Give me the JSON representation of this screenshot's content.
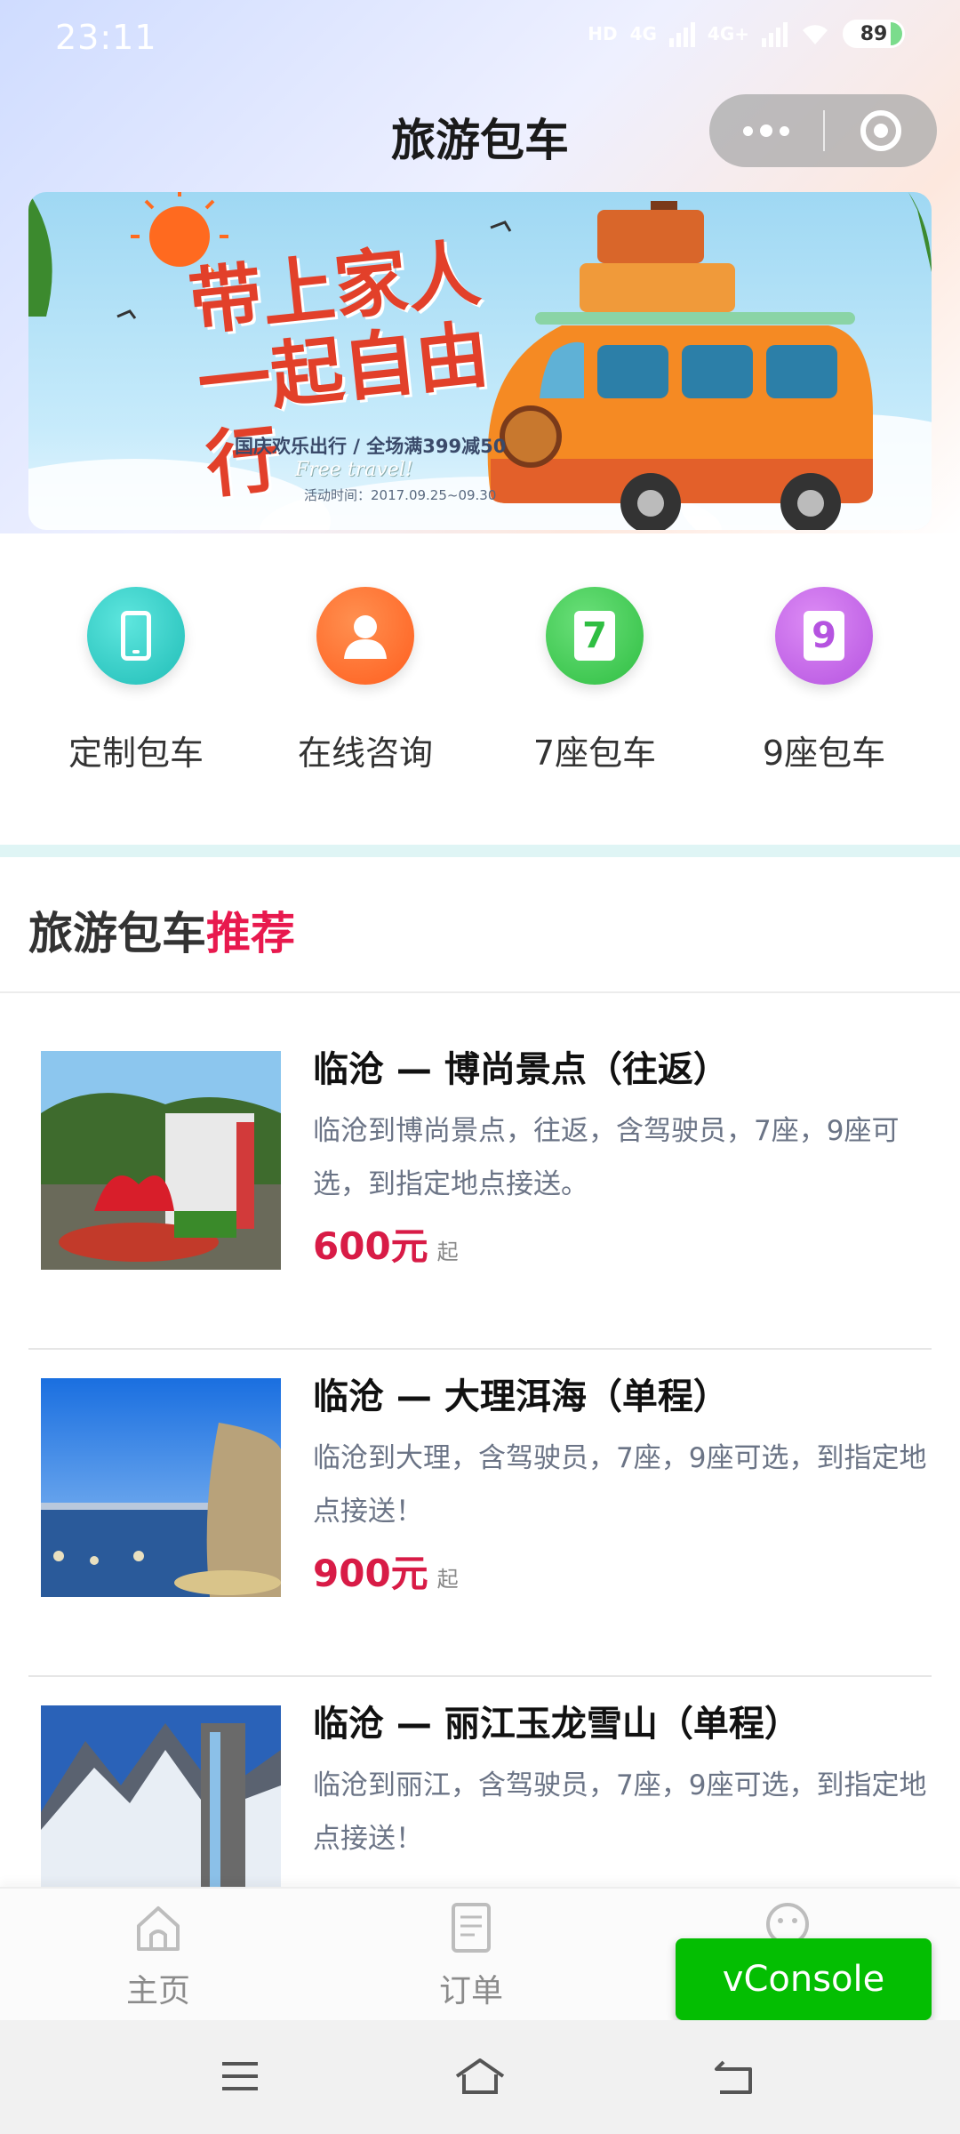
{
  "status_bar": {
    "time": "23:11",
    "network_chip": "HD",
    "signal1_label": "4G",
    "signal2_label": "4G+",
    "battery": "89"
  },
  "navbar": {
    "title": "旅游包车"
  },
  "banner": {
    "headline": "带上家人一起自由行",
    "subtitle": "国庆欢乐出行 / 全场满399减50",
    "english": "Free travel!",
    "date": "活动时间：2017.09.25~09.30"
  },
  "categories": [
    {
      "label": "定制包车",
      "icon": "phone-icon",
      "color": "#2cc9c4"
    },
    {
      "label": "在线咨询",
      "icon": "user-icon",
      "color": "#ff6a2a"
    },
    {
      "label": "7座包车",
      "icon": "seven-icon",
      "glyph": "7",
      "color": "#3dc94f"
    },
    {
      "label": "9座包车",
      "icon": "nine-icon",
      "glyph": "9",
      "color": "#c262e8"
    }
  ],
  "section": {
    "title_main": "旅游包车",
    "title_highlight": "推荐"
  },
  "items": [
    {
      "title": "临沧 — 博尚景点（往返）",
      "desc": "临沧到博尚景点，往返，含驾驶员，7座，9座可选，到指定地点接送。",
      "price": "600元",
      "suffix": "起"
    },
    {
      "title": "临沧 — 大理洱海（单程）",
      "desc": "临沧到大理，含驾驶员，7座，9座可选，到指定地点接送！",
      "price": "900元",
      "suffix": "起"
    },
    {
      "title": "临沧 — 丽江玉龙雪山（单程）",
      "desc": "临沧到丽江，含驾驶员，7座，9座可选，到指定地点接送！",
      "price": "",
      "suffix": ""
    }
  ],
  "tabbar": {
    "home": "主页",
    "orders": "订单"
  },
  "vconsole": "vConsole",
  "colors": {
    "accent": "#e8194e",
    "vconsole": "#04be02"
  }
}
